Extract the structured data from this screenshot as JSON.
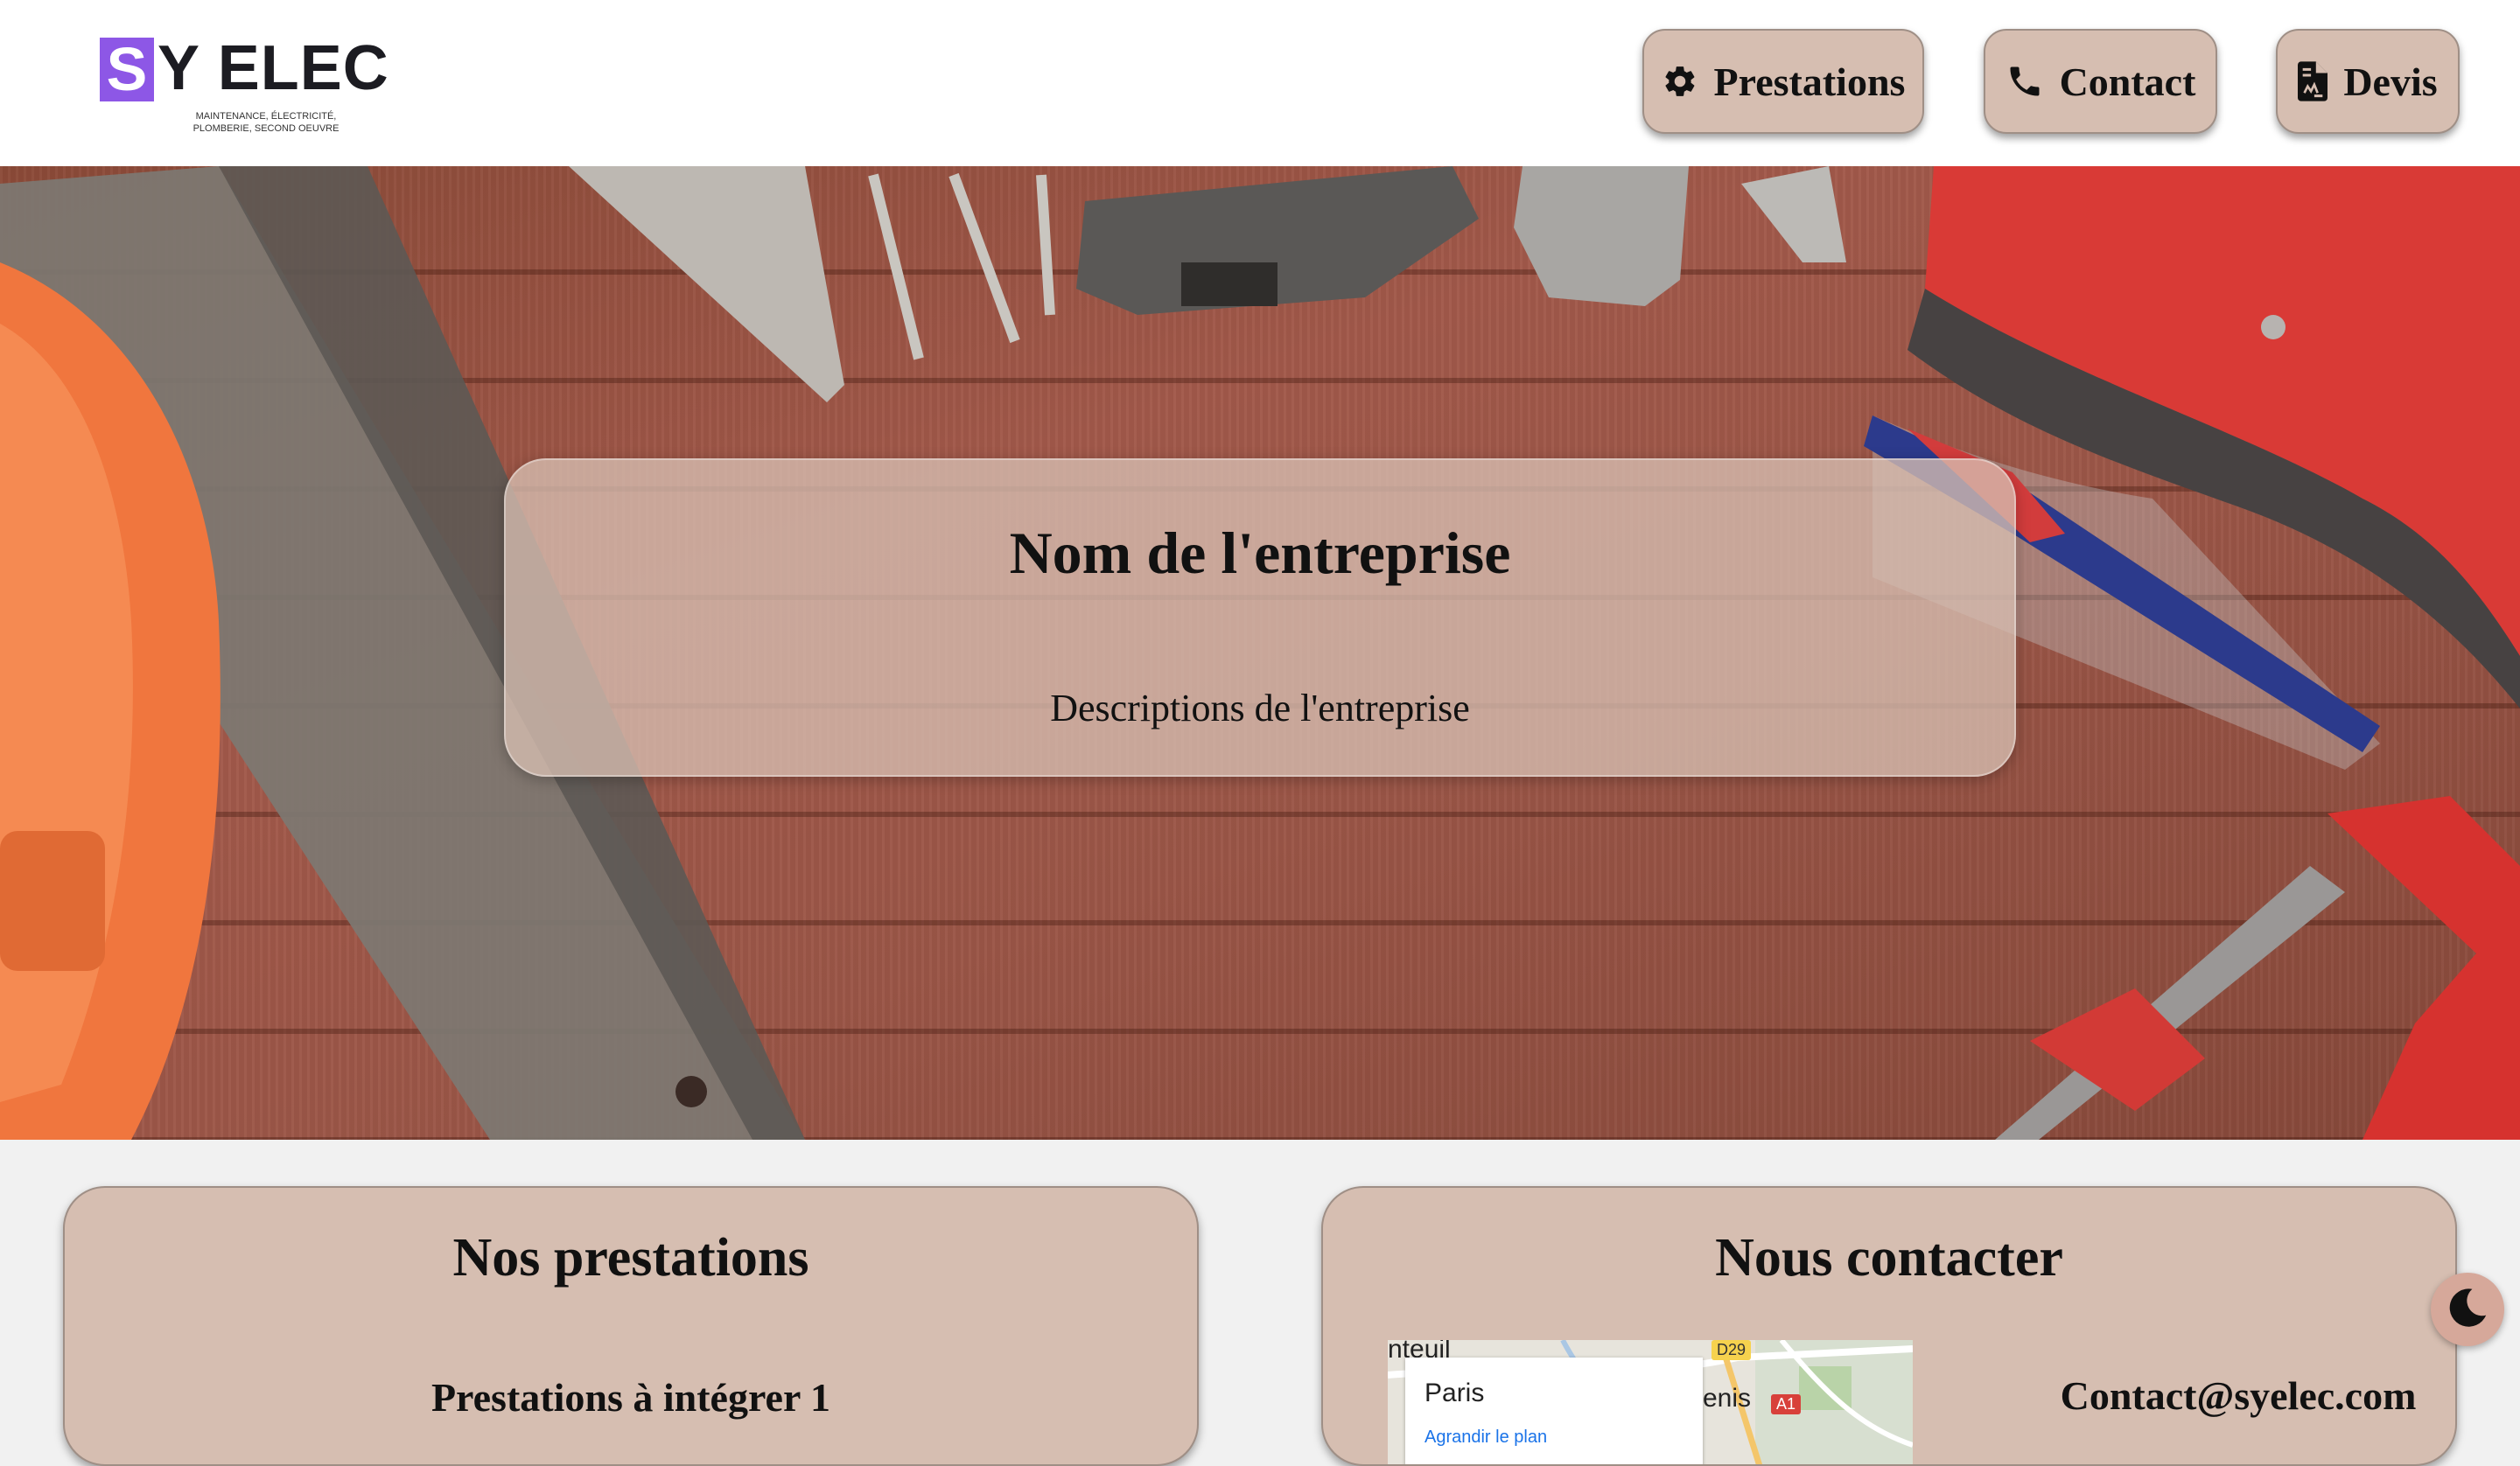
{
  "header": {
    "logo": {
      "letter": "S",
      "word": "Y ELEC",
      "tagline_line1": "Maintenance, électricité,",
      "tagline_line2": "plomberie, second oeuvre"
    },
    "nav": [
      {
        "label": "Prestations",
        "icon": "gear-icon"
      },
      {
        "label": "Contact",
        "icon": "phone-icon"
      },
      {
        "label": "Devis",
        "icon": "file-invoice-icon"
      }
    ]
  },
  "hero": {
    "title": "Nom de l'entreprise",
    "description": "Descriptions de l'entreprise"
  },
  "services": {
    "title": "Nos prestations",
    "items": [
      "Prestations à intégrer 1"
    ]
  },
  "contact": {
    "title": "Nous contacter",
    "email": "Contact@syelec.com",
    "map": {
      "place_label": "Paris",
      "link_text": "Agrandir le plan",
      "labels": [
        "nteuil",
        "enis"
      ],
      "road_badges": [
        "D29",
        "A1"
      ]
    }
  },
  "theme_toggle": {
    "icon": "moon-icon"
  },
  "colors": {
    "card_bg": "#d6beb1",
    "logo_accent": "#8d57e6",
    "page_bg": "#f1f1f1"
  }
}
